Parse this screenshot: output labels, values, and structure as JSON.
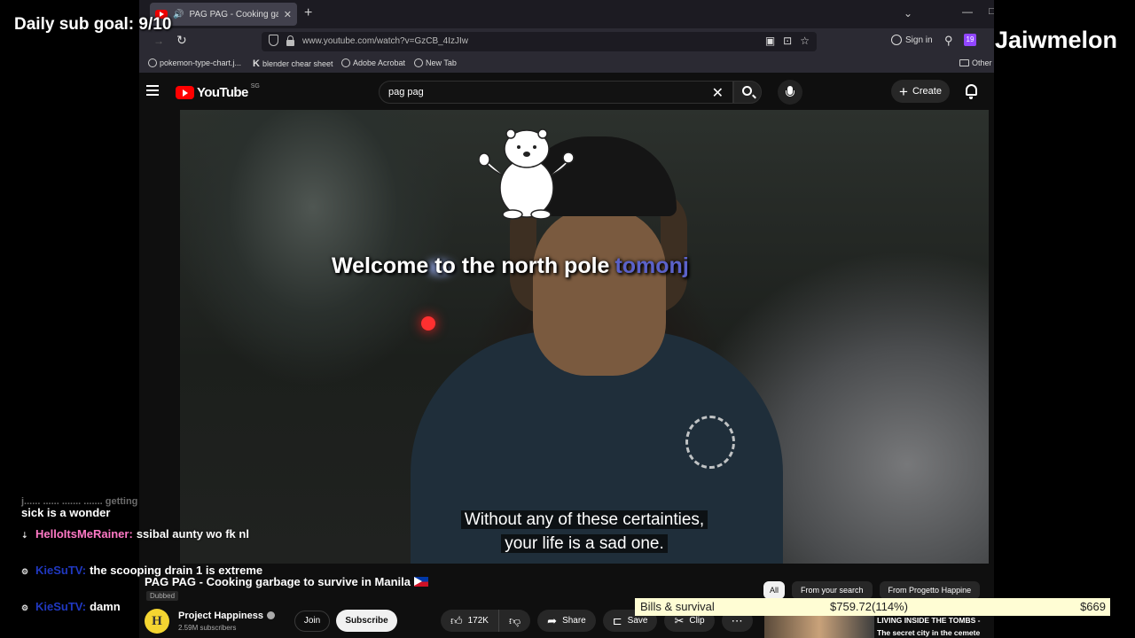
{
  "overlay": {
    "sub_goal": "Daily sub goal: 9/10",
    "streamer_name": "Jaiwmelon",
    "bills": {
      "label": "Bills & survival",
      "current": "$759.72(114%)",
      "target": "$669"
    }
  },
  "chat": [
    {
      "user": "",
      "text": "sick is a wonder",
      "partial_prefix": "j...... ...... ....... ....... getting"
    },
    {
      "user": "HelloItsMeRainer:",
      "text": "ssibal aunty wo fk nl"
    },
    {
      "user": "KieSuTV:",
      "text": "the scooping drain 1 is extreme"
    },
    {
      "user": "KieSuTV:",
      "text": "damn"
    }
  ],
  "browser": {
    "tab_title": "PAG PAG - Cooking garbag",
    "url": "www.youtube.com/watch?v=GzCB_4IzJIw",
    "sign_in": "Sign in",
    "twitch_count": "19",
    "bookmarks": [
      "pokemon-type-chart.j...",
      "blender chear sheet",
      "Adobe Acrobat",
      "New Tab"
    ],
    "other_bookmarks": "Other b"
  },
  "youtube": {
    "logo_word": "YouTube",
    "logo_country": "SG",
    "search_query": "pag pag",
    "create_label": "Create"
  },
  "video": {
    "overlay_text": "Welcome to the north pole",
    "overlay_user": "tomonj",
    "subtitle_line1": "Without any of these certainties,",
    "subtitle_line2": "your life is a sad one."
  },
  "meta": {
    "title": "PAG PAG - Cooking garbage to survive in Manila",
    "dubbed": "Dubbed",
    "channel": "Project Happiness",
    "channel_initial": "H",
    "subscribers": "2.59M subscribers",
    "join": "Join",
    "subscribe": "Subscribe",
    "likes": "172K",
    "share": "Share",
    "save": "Save",
    "clip": "Clip"
  },
  "chips": [
    "All",
    "From your search",
    "From Progetto Happine"
  ],
  "recommended": {
    "title_line1": "LIVING INSIDE THE TOMBS -",
    "title_line2": "The secret city in the cemete"
  },
  "colors": {
    "yt_red": "#ff0000",
    "bills_bg": "#fffdd4",
    "twitch_purple": "#9146ff",
    "chat_pink": "#ff79c6",
    "chat_blue": "#2038c0"
  }
}
